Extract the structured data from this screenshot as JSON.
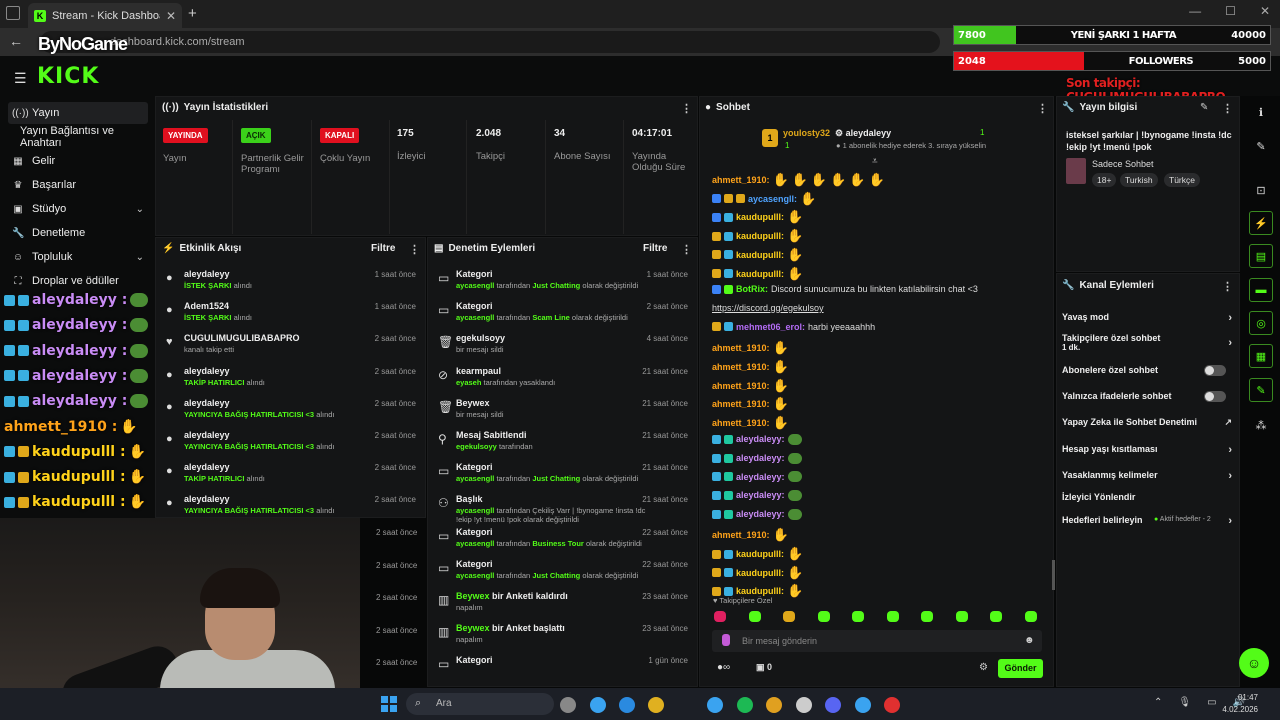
{
  "browser": {
    "tab_title": "Stream - Kick Dashboard",
    "url": "dashboard.kick.com/stream",
    "watermark": "ByNoGame"
  },
  "overlay": {
    "goal1": {
      "value": "7800",
      "label": "YENİ ŞARKI 1 HAFTA",
      "max": "40000",
      "fraction": 0.195,
      "color": "#41c51f"
    },
    "goal2": {
      "value": "2048",
      "label": "FOLLOWERS",
      "max": "5000",
      "fraction": 0.41,
      "color": "#e4121c"
    },
    "last_follower": "Son takipçi: CUGULIMUGULIBABAPRO"
  },
  "sidebar": {
    "items": [
      {
        "label": "Yayın",
        "icon": "broadcast-icon"
      },
      {
        "label": "Yayın Bağlantısı ve Anahtarı",
        "icon": ""
      },
      {
        "label": "Gelir",
        "icon": "revenue-icon"
      },
      {
        "label": "Başarılar",
        "icon": "trophy-icon"
      },
      {
        "label": "Stüdyo",
        "icon": "studio-icon"
      },
      {
        "label": "Denetleme",
        "icon": "wrench-icon"
      },
      {
        "label": "Topluluk",
        "icon": "community-icon"
      },
      {
        "label": "Droplar ve ödüller",
        "icon": "gift-icon"
      }
    ]
  },
  "overlay_chat": [
    {
      "name": "aleydaleyy :",
      "color": "#c98cf5"
    },
    {
      "name": "aleydaleyy :",
      "color": "#c98cf5"
    },
    {
      "name": "aleydaleyy :",
      "color": "#c98cf5"
    },
    {
      "name": "aleydaleyy :",
      "color": "#c98cf5"
    },
    {
      "name": "aleydaleyy :",
      "color": "#c98cf5"
    },
    {
      "name": "ahmett_1910 :",
      "color": "#ffa31a"
    },
    {
      "name": "kaudupulll :",
      "color": "#ffd21a"
    },
    {
      "name": "kaudupulll :",
      "color": "#ffd21a"
    },
    {
      "name": "kaudupulll :",
      "color": "#ffd21a"
    }
  ],
  "stats": {
    "title": "Yayın İstatistikleri",
    "live": {
      "badge": "YAYINDA",
      "label": "Yayın"
    },
    "partner": {
      "badge": "AÇIK",
      "label": "Partnerlik Gelir Programı"
    },
    "multi": {
      "badge": "KAPALI",
      "label": "Çoklu Yayın"
    },
    "viewers": {
      "value": "175",
      "label": "İzleyici"
    },
    "followers": {
      "value": "2.048",
      "label": "Takipçi"
    },
    "subs": {
      "value": "34",
      "label": "Abone Sayısı"
    },
    "uptime": {
      "value": "04:17:01",
      "label": "Yayında Olduğu Süre"
    }
  },
  "activity": {
    "title": "Etkinlik Akışı",
    "filter": "Filtre",
    "rows": [
      {
        "name": "aleydaleyy",
        "action": "İSTEK ŞARKI",
        "suffix": " alındı",
        "time": "1 saat önce",
        "icon": "user-icon"
      },
      {
        "name": "Adem1524",
        "action": "İSTEK ŞARKI",
        "suffix": " alındı",
        "time": "1 saat önce",
        "icon": "user-icon"
      },
      {
        "name": "CUGULIMUGULIBABAPRO",
        "action": "",
        "suffix": "kanalı takip etti",
        "time": "2 saat önce",
        "icon": "heart-icon"
      },
      {
        "name": "aleydaleyy",
        "action": "TAKİP HATIRLICI",
        "suffix": " alındı",
        "time": "2 saat önce",
        "icon": "user-icon"
      },
      {
        "name": "aleydaleyy",
        "action": "YAYINCIYA BAĞIŞ HATIRLATICISI &lt;3",
        "suffix": " alındı",
        "time": "2 saat önce",
        "icon": "user-icon"
      },
      {
        "name": "aleydaleyy",
        "action": "YAYINCIYA BAĞIŞ HATIRLATICISI &lt;3",
        "suffix": " alındı",
        "time": "2 saat önce",
        "icon": "user-icon"
      },
      {
        "name": "aleydaleyy",
        "action": "TAKİP HATIRLICI",
        "suffix": " alındı",
        "time": "2 saat önce",
        "icon": "user-icon"
      },
      {
        "name": "aleydaleyy",
        "action": "YAYINCIYA BAĞIŞ HATIRLATICISI &lt;3",
        "suffix": " alındı",
        "time": "2 saat önce",
        "icon": "user-icon"
      }
    ],
    "extra_times": [
      "2 saat önce",
      "2 saat önce",
      "2 saat önce",
      "2 saat önce",
      "2 saat önce"
    ]
  },
  "moderation": {
    "title": "Denetim Eylemleri",
    "filter": "Filtre",
    "rows": [
      {
        "title": "Kategori",
        "green_title": false,
        "actor": "aycasengll",
        "text": " tarafından ",
        "target": "Just Chatting",
        "tail": " olarak değiştirildi",
        "time": "1 saat önce",
        "icon": "category-icon"
      },
      {
        "title": "Kategori",
        "green_title": false,
        "actor": "aycasengll",
        "text": " tarafından ",
        "target": "Scam Line",
        "tail": " olarak değiştirildi",
        "time": "2 saat önce",
        "icon": "category-icon"
      },
      {
        "title": "egekulsoyy",
        "green_title": false,
        "actor": "",
        "text": "bir mesajı sildi",
        "target": "",
        "tail": "",
        "time": "4 saat önce",
        "icon": "trash-icon"
      },
      {
        "title": "kearmpaul",
        "green_title": false,
        "actor": "eyaseh",
        "text": " tarafından yasaklandı",
        "target": "",
        "tail": "",
        "time": "21 saat önce",
        "icon": "ban-icon"
      },
      {
        "title": "Beywex",
        "green_title": false,
        "actor": "",
        "text": "bir mesajı sildi",
        "target": "",
        "tail": "",
        "time": "21 saat önce",
        "icon": "trash-icon"
      },
      {
        "title": "Mesaj Sabitlendi",
        "green_title": false,
        "actor": "egekulsoyy",
        "text": " tarafından",
        "target": "",
        "tail": "",
        "time": "21 saat önce",
        "icon": "pin-icon"
      },
      {
        "title": "Kategori",
        "green_title": false,
        "actor": "aycasengll",
        "text": " tarafından ",
        "target": "Just Chatting",
        "tail": " olarak değiştirildi",
        "time": "21 saat önce",
        "icon": "category-icon"
      },
      {
        "title": "Başlık",
        "green_title": false,
        "actor": "aycasengll",
        "text": " tarafından Çekiliş Varr | !bynogame !insta !dc !ekip !yt !menü !pok olarak değiştirildi",
        "target": "",
        "tail": "",
        "time": "21 saat önce",
        "icon": "title-icon"
      },
      {
        "title": "Kategori",
        "green_title": false,
        "actor": "aycasengll",
        "text": " tarafından ",
        "target": "Business Tour",
        "tail": " olarak değiştirildi",
        "time": "22 saat önce",
        "icon": "category-icon"
      },
      {
        "title": "Kategori",
        "green_title": false,
        "actor": "aycasengll",
        "text": " tarafından ",
        "target": "Just Chatting",
        "tail": " olarak değiştirildi",
        "time": "22 saat önce",
        "icon": "category-icon"
      },
      {
        "title": "Beywex",
        "green_title": true,
        "title_tail": " bir Anketi kaldırdı",
        "actor": "",
        "text": "napalım",
        "target": "",
        "tail": "",
        "time": "23 saat önce",
        "icon": "poll-icon"
      },
      {
        "title": "Beywex",
        "green_title": true,
        "title_tail": " bir Anket başlattı",
        "actor": "",
        "text": "napalım",
        "target": "",
        "tail": "",
        "time": "23 saat önce",
        "icon": "poll-icon"
      },
      {
        "title": "Kategori",
        "green_title": false,
        "actor": "",
        "text": "",
        "target": "",
        "tail": "",
        "time": "1 gün önce",
        "icon": "category-icon"
      }
    ]
  },
  "chat": {
    "title": "Sohbet",
    "gift_user": "youlosty32",
    "gift_target": "aleydaleyy",
    "gift_count1": "1",
    "gift_count2": "1",
    "gift_text": "1 abonelik hediye ederek 3. sıraya yükselin",
    "messages": [
      {
        "user": "ahmett_1910:",
        "color": "#ffa31a",
        "badges": [],
        "emotes": 6,
        "text": ""
      },
      {
        "user": "aycasengll:",
        "color": "#4fa3ff",
        "badges": [
          "#3b82f6",
          "#e0a81a",
          "#e0a81a"
        ],
        "emotes": 1,
        "text": ""
      },
      {
        "user": "kaudupulll:",
        "color": "#ffd21a",
        "badges": [
          "#3b82f6",
          "#3ab0e0"
        ],
        "emotes": 1,
        "text": ""
      },
      {
        "user": "kaudupulll:",
        "color": "#ffd21a",
        "badges": [
          "#e0a81a",
          "#3ab0e0"
        ],
        "emotes": 1,
        "text": ""
      },
      {
        "user": "kaudupulll:",
        "color": "#ffd21a",
        "badges": [
          "#e0a81a",
          "#3ab0e0"
        ],
        "emotes": 1,
        "text": ""
      },
      {
        "user": "kaudupulll:",
        "color": "#ffd21a",
        "badges": [
          "#e0a81a",
          "#3ab0e0"
        ],
        "emotes": 1,
        "text": ""
      },
      {
        "user": "BotRix:",
        "color": "#53fc18",
        "badges": [
          "#3b82f6",
          "#53fc18"
        ],
        "emotes": 0,
        "text": " Discord sunucumuza bu linkten katılabilirsin chat <3"
      },
      {
        "user": "",
        "color": "#ddd",
        "badges": [],
        "emotes": 0,
        "text": "https://discord.gg/egekulsoy"
      },
      {
        "user": "mehmet06_erol:",
        "color": "#b46cf5",
        "badges": [
          "#e0a81a",
          "#3ab0e0"
        ],
        "emotes": 0,
        "text": " harbi yeeaaahhh"
      },
      {
        "user": "ahmett_1910:",
        "color": "#ffa31a",
        "badges": [],
        "emotes": 1,
        "text": ""
      },
      {
        "user": "ahmett_1910:",
        "color": "#ffa31a",
        "badges": [],
        "emotes": 1,
        "text": ""
      },
      {
        "user": "ahmett_1910:",
        "color": "#ffa31a",
        "badges": [],
        "emotes": 1,
        "text": ""
      },
      {
        "user": "ahmett_1910:",
        "color": "#ffa31a",
        "badges": [],
        "emotes": 1,
        "text": ""
      },
      {
        "user": "ahmett_1910:",
        "color": "#ffa31a",
        "badges": [],
        "emotes": 1,
        "text": ""
      },
      {
        "user": "aleydaleyy:",
        "color": "#c98cf5",
        "badges": [
          "#3ab0e0",
          "#1fc8a0"
        ],
        "emotes": -1,
        "text": ""
      },
      {
        "user": "aleydaleyy:",
        "color": "#c98cf5",
        "badges": [
          "#3ab0e0",
          "#1fc8a0"
        ],
        "emotes": -1,
        "text": ""
      },
      {
        "user": "aleydaleyy:",
        "color": "#c98cf5",
        "badges": [
          "#3ab0e0",
          "#1fc8a0"
        ],
        "emotes": -1,
        "text": ""
      },
      {
        "user": "aleydaleyy:",
        "color": "#c98cf5",
        "badges": [
          "#3ab0e0",
          "#1fc8a0"
        ],
        "emotes": -1,
        "text": ""
      },
      {
        "user": "aleydaleyy:",
        "color": "#c98cf5",
        "badges": [
          "#3ab0e0",
          "#1fc8a0"
        ],
        "emotes": -1,
        "text": ""
      },
      {
        "user": "ahmett_1910:",
        "color": "#ffa31a",
        "badges": [],
        "emotes": 1,
        "text": ""
      },
      {
        "user": "kaudupulll:",
        "color": "#ffd21a",
        "badges": [
          "#e0a81a",
          "#3ab0e0"
        ],
        "emotes": 1,
        "text": ""
      },
      {
        "user": "kaudupulll:",
        "color": "#ffd21a",
        "badges": [
          "#e0a81a",
          "#3ab0e0"
        ],
        "emotes": 1,
        "text": ""
      },
      {
        "user": "kaudupulll:",
        "color": "#ffd21a",
        "badges": [
          "#e0a81a",
          "#3ab0e0"
        ],
        "emotes": 1,
        "text": ""
      }
    ],
    "followers_only_label": "Takipçilere Özel",
    "input_placeholder": "Bir mesaj gönderin",
    "viewer_count_icon": "∞",
    "slow_count": "0",
    "send": "Gönder"
  },
  "info": {
    "title": "Yayın bilgisi",
    "stream_title": "isteksel şarkılar | !bynogame !insta !dc !ekip !yt !menü !pok",
    "category": "Sadece Sohbet",
    "tags": [
      "18+",
      "Turkish",
      "Türkçe"
    ]
  },
  "channel_actions": {
    "title": "Kanal Eylemleri",
    "slow_mode": "Yavaş mod",
    "followers_chat": "Takipçilere özel sohbet",
    "followers_chat_value": "1 dk.",
    "subs_chat": "Abonelere özel sohbet",
    "emotes_chat": "Yalnızca ifadelerle sohbet",
    "ai_moderation": "Yapay Zeka ile Sohbet Denetimi",
    "age_limits": "Hesap yaşı kısıtlaması",
    "banned_words": "Yasaklanmış kelimeler",
    "viewer_redirect": "İzleyici Yönlendir",
    "set_goals": "Hedefleri belirleyin",
    "goals_status": "Aktif hedefler - 2"
  },
  "taskbar": {
    "search": "Ara",
    "time": "01:47",
    "date": "4.02.2026"
  }
}
